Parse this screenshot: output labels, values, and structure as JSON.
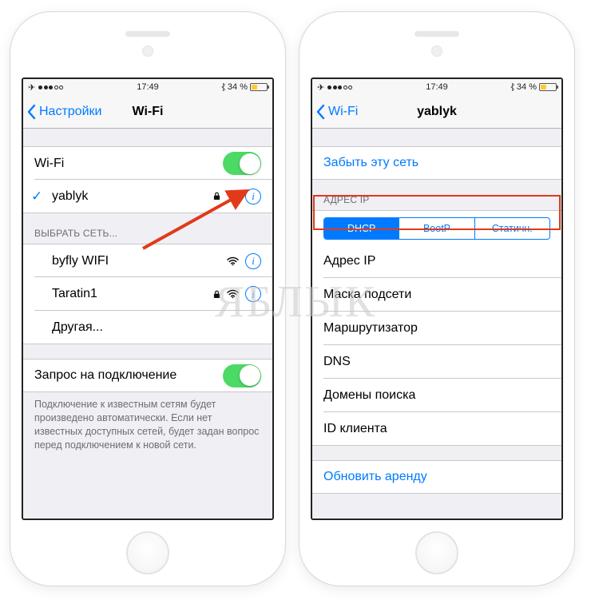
{
  "status": {
    "time": "17:49",
    "battery_pct": "34 %",
    "battery_fill_pct": 34
  },
  "phone_left": {
    "back_label": "Настройки",
    "title": "Wi-Fi",
    "wifi_toggle_label": "Wi-Fi",
    "connected_network": "yablyk",
    "choose_network_header": "ВЫБРАТЬ СЕТЬ...",
    "networks": [
      {
        "name": "byfly WIFI",
        "locked": false
      },
      {
        "name": "Taratin1",
        "locked": true
      }
    ],
    "other_label": "Другая...",
    "ask_to_join_label": "Запрос на подключение",
    "ask_to_join_footer": "Подключение к известным сетям будет произведено автоматически. Если нет известных доступных сетей, будет задан вопрос перед подключением к новой сети."
  },
  "phone_right": {
    "back_label": "Wi-Fi",
    "title": "yablyk",
    "forget_label": "Забыть эту сеть",
    "ip_header": "АДРЕС IP",
    "tabs": {
      "dhcp": "DHCP",
      "bootp": "BootP",
      "static": "Статичн."
    },
    "fields": {
      "ip": "Адрес IP",
      "mask": "Маска подсети",
      "router": "Маршрутизатор",
      "dns": "DNS",
      "search": "Домены поиска",
      "client": "ID клиента"
    },
    "renew_label": "Обновить аренду"
  },
  "watermark": "ЯБЛЫК"
}
